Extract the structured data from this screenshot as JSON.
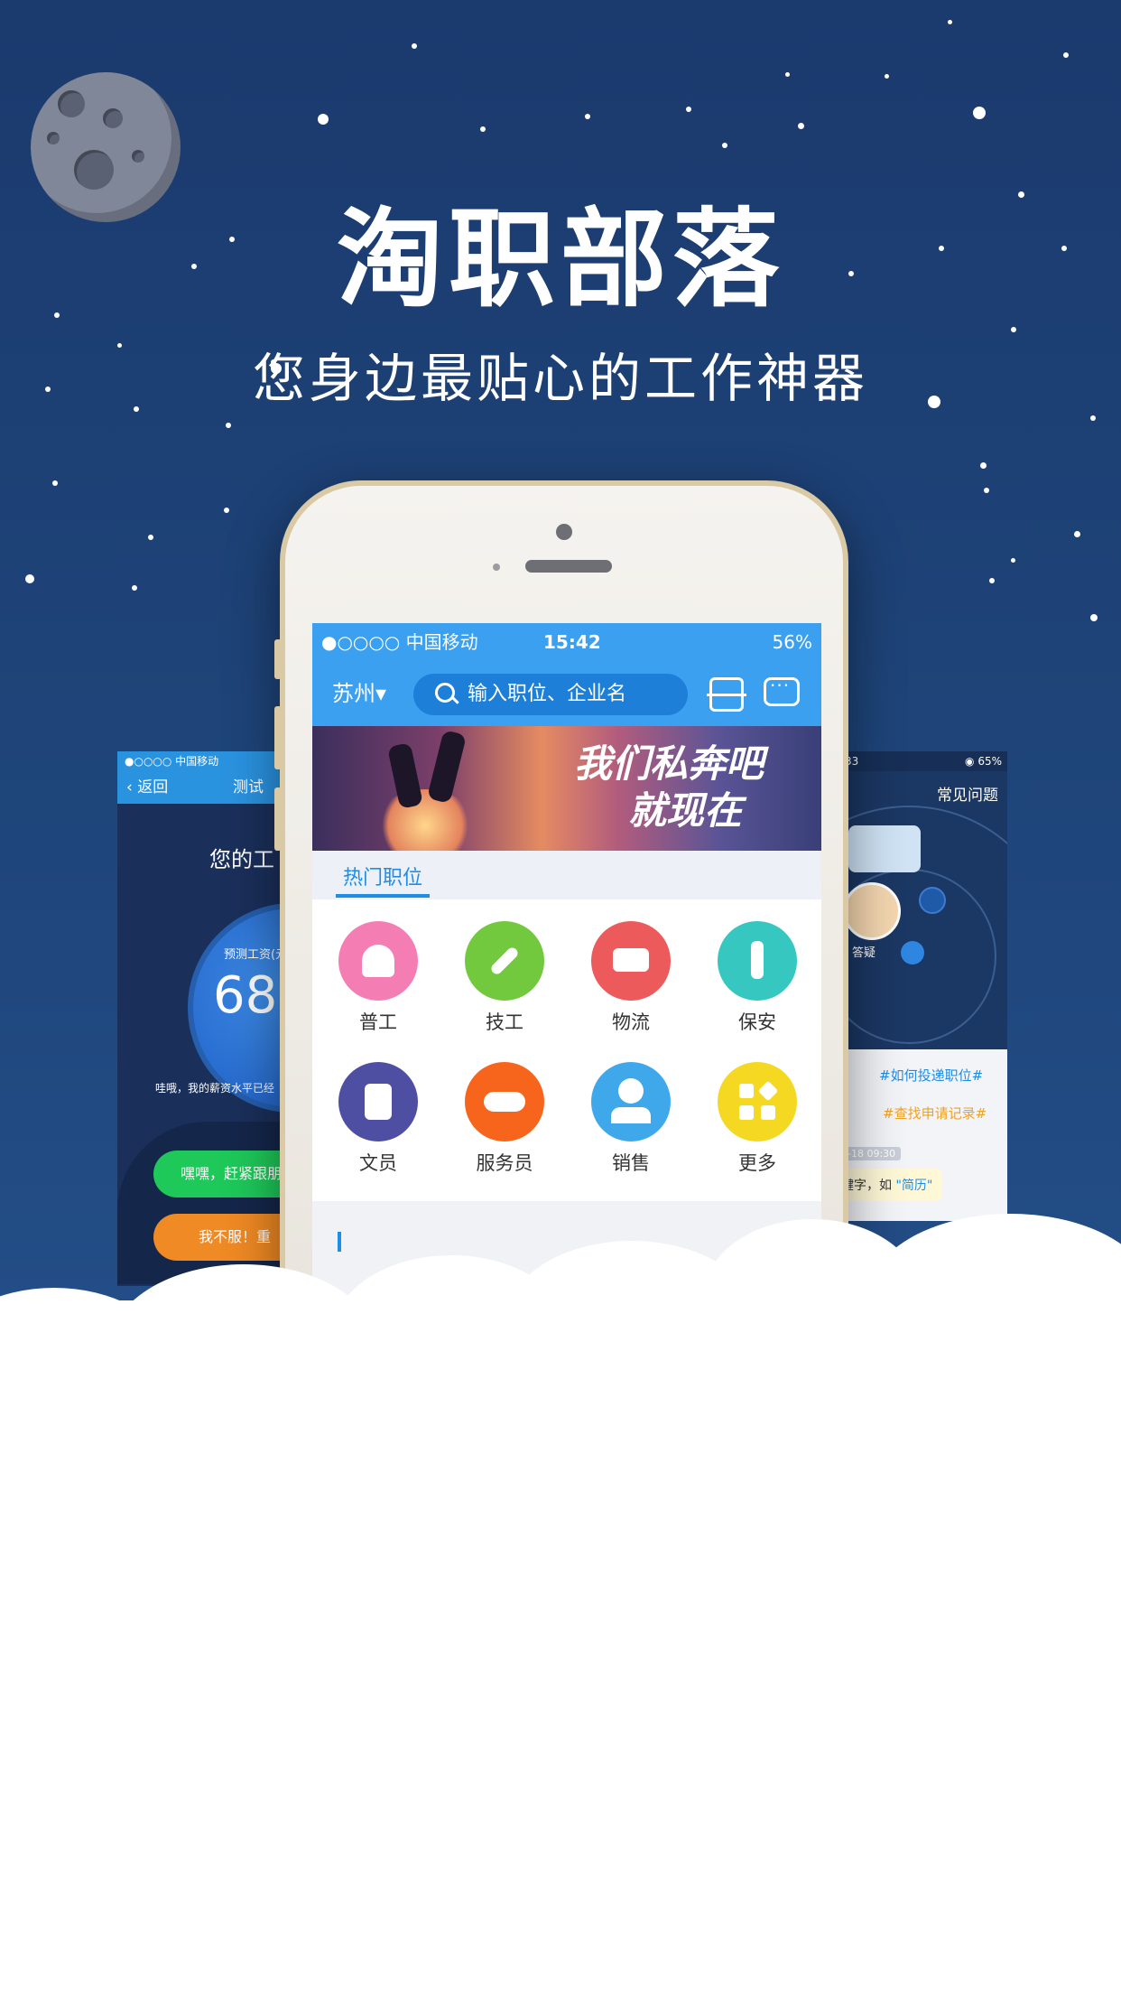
{
  "hero": {
    "title": "淘职部落",
    "subtitle": "您身边最贴心的工作神器"
  },
  "left_screen": {
    "status": "●○○○○ 中国移动",
    "back_label": "返回",
    "title": "测试",
    "question": "您的工",
    "salary_label": "预测工资(元",
    "salary_value": "685",
    "note": "哇哦，我的薪资水平已经",
    "button_primary": "嘿嘿，赶紧跟朋",
    "button_secondary": "我不服！重"
  },
  "right_screen": {
    "status_left": ":33",
    "status_right": "◉ 65%",
    "title": "常见问题",
    "avatar_label": "答疑",
    "quick_q1": "#如何投递职位#",
    "quick_q2": "#查找申请记录#",
    "timestamp": "0-18 09:30",
    "message_prefix": "键字，如",
    "message_highlight": "\"简历\""
  },
  "phone": {
    "status": {
      "carrier": "●○○○○ 中国移动",
      "time": "15:42",
      "battery": "56%"
    },
    "city": "苏州▾",
    "search_placeholder": "输入职位、企业名",
    "banner": {
      "line1": "我们私奔吧",
      "line2": "就现在"
    },
    "section_tab": "热门职位",
    "categories": [
      {
        "label": "普工",
        "color": "#f47eb3",
        "icon": "boxes-icon"
      },
      {
        "label": "技工",
        "color": "#72c93e",
        "icon": "wrench-icon"
      },
      {
        "label": "物流",
        "color": "#ec5a5c",
        "icon": "truck-icon"
      },
      {
        "label": "保安",
        "color": "#35c7c0",
        "icon": "tie-icon"
      },
      {
        "label": "文员",
        "color": "#4e4fa3",
        "icon": "document-icon"
      },
      {
        "label": "服务员",
        "color": "#f7641c",
        "icon": "service-icon"
      },
      {
        "label": "销售",
        "color": "#3fa8ea",
        "icon": "person-icon"
      },
      {
        "label": "更多",
        "color": "#f5d821",
        "icon": "grid-icon"
      }
    ]
  },
  "colors": {
    "sky": "#1e4479",
    "accent": "#3aa0ef",
    "brand_blue": "#1e8de6"
  }
}
